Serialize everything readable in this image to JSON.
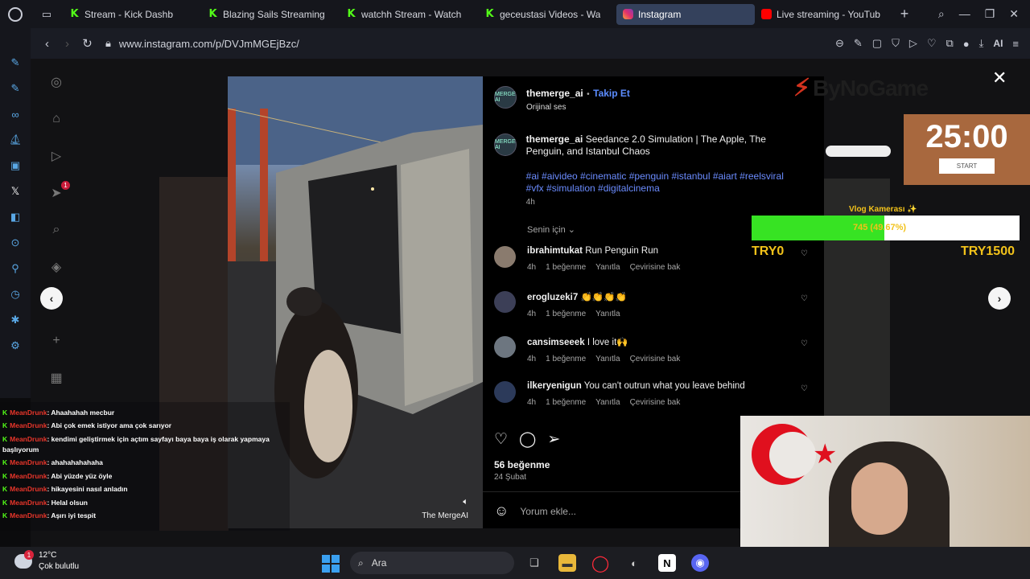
{
  "browser": {
    "tabs": [
      {
        "title": "Stream - Kick Dashb",
        "favicon": "kick-icon",
        "active": false
      },
      {
        "title": "Blazing Sails Streaming",
        "favicon": "kick-icon",
        "active": false
      },
      {
        "title": "watchh Stream - Watch",
        "favicon": "kick-icon",
        "active": false
      },
      {
        "title": "geceustasi Videos - Wa",
        "favicon": "kick-icon",
        "active": false
      },
      {
        "title": "Instagram",
        "favicon": "instagram-icon",
        "active": true
      },
      {
        "title": "Live streaming - YouTub",
        "favicon": "youtube-icon",
        "active": false
      }
    ],
    "url": "www.instagram.com/p/DVJmMGEjBzc/",
    "ai_label": "AI"
  },
  "post": {
    "username": "themerge_ai",
    "separator": "•",
    "follow_label": "Takip Et",
    "audio": "Orijinal ses",
    "caption_user": "themerge_ai",
    "caption_text": "Seedance 2.0 Simulation | The Apple, The Penguin, and Istanbul Chaos",
    "hashtags": "#ai #aivideo #cinematic #penguin #istanbul #aiart #reelsviral #vfx #simulation #digitalcinema",
    "caption_time": "4h",
    "for_you": "Senin için",
    "media_credit": "The MergeAI",
    "avatar_text": "MERGE AI",
    "comments": [
      {
        "user": "ibrahimtukat",
        "text": "Run Penguin Run",
        "time": "4h",
        "likes": "1 beğenme",
        "reply": "Yanıtla",
        "translate": "Çevirisine bak"
      },
      {
        "user": "erogluzeki7",
        "text": "👏👏👏👏",
        "time": "4h",
        "likes": "1 beğenme",
        "reply": "Yanıtla",
        "translate": ""
      },
      {
        "user": "cansimseeek",
        "text": "I love it🙌",
        "time": "4h",
        "likes": "1 beğenme",
        "reply": "Yanıtla",
        "translate": "Çevirisine bak"
      },
      {
        "user": "ilkeryenigun",
        "text": "You can't outrun what you leave behind",
        "time": "4h",
        "likes": "1 beğenme",
        "reply": "Yanıtla",
        "translate": "Çevirisine bak"
      }
    ],
    "likes": "56 beğenme",
    "date": "24 Şubat",
    "comment_placeholder": "Yorum ekle..."
  },
  "ig_nav": {
    "notification_badge": "1"
  },
  "overlay": {
    "brand": "ByNoGame",
    "timer": "25:00",
    "timer_button": "START",
    "vlog_title": "Vlog Kamerası ✨",
    "goal_text": "745 (49.67%)",
    "goal_fraction": 0.4967,
    "goal_min": "TRY0",
    "goal_max": "TRY1500"
  },
  "chat": [
    {
      "user": "MeanDrunk",
      "text": ": Ahaahahah mecbur"
    },
    {
      "user": "MeanDrunk",
      "text": ": Abi çok emek istiyor ama çok sarıyor"
    },
    {
      "user": "MeanDrunk",
      "text": ": kendimi geliştirmek için açtım sayfayı baya baya iş olarak yapmaya"
    },
    {
      "user": "",
      "text": "başlıyorum"
    },
    {
      "user": "MeanDrunk",
      "text": ": ahahahahahaha"
    },
    {
      "user": "MeanDrunk",
      "text": ": Abi yüzde yüz öyle"
    },
    {
      "user": "MeanDrunk",
      "text": ": hikayesini nasıl anladın"
    },
    {
      "user": "MeanDrunk",
      "text": ": Helal olsun"
    },
    {
      "user": "MeanDrunk",
      "text": ": Aşırı iyi tespit"
    }
  ],
  "taskbar": {
    "temperature": "12°C",
    "weather": "Çok bulutlu",
    "weather_badge": "1",
    "search_label": "Ara"
  },
  "colors": {
    "accent": "#5b8cff",
    "kick": "#53fc18",
    "goal_fill": "#37e323",
    "goal_text": "#f2c21a"
  }
}
